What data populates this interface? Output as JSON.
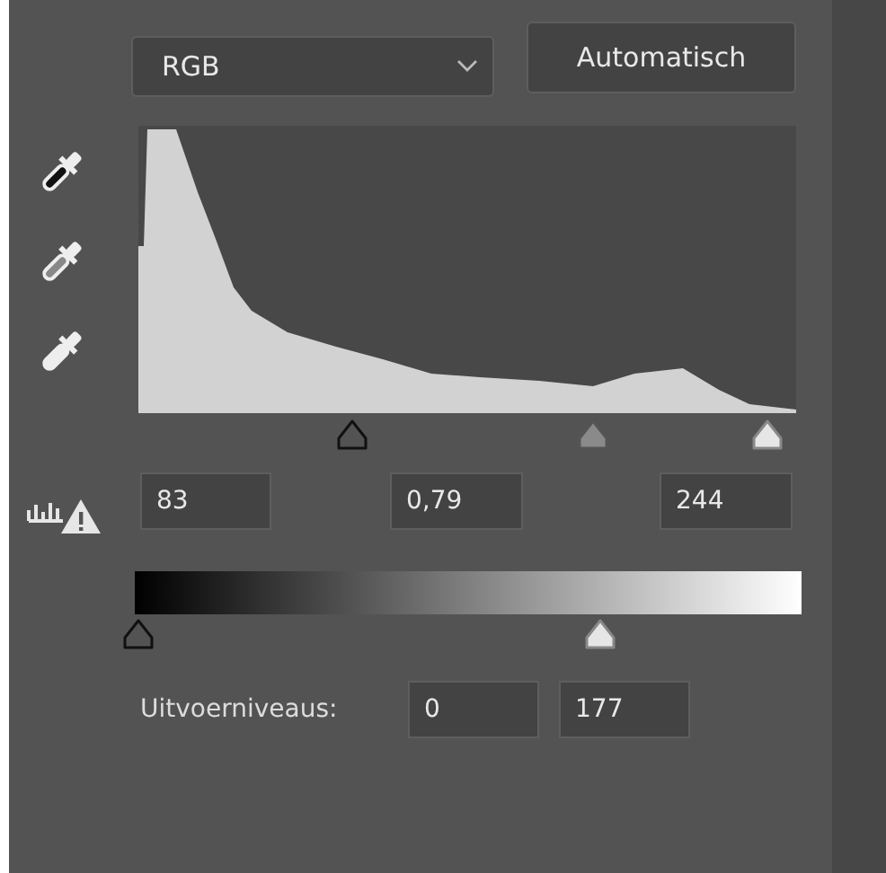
{
  "channel_select": {
    "value": "RGB"
  },
  "auto_button": "Automatisch",
  "input_sliders": [
    {
      "kind": "black",
      "level": 0.325
    },
    {
      "kind": "gray",
      "level": 0.69
    },
    {
      "kind": "white",
      "level": 0.957
    }
  ],
  "input_fields": [
    "83",
    "0,79",
    "244"
  ],
  "output_sliders": [
    {
      "kind": "black",
      "level": 0
    },
    {
      "kind": "white",
      "level": 0.694
    }
  ],
  "output_label": "Uitvoerniveaus:",
  "output_fields": [
    "0",
    "177"
  ]
}
